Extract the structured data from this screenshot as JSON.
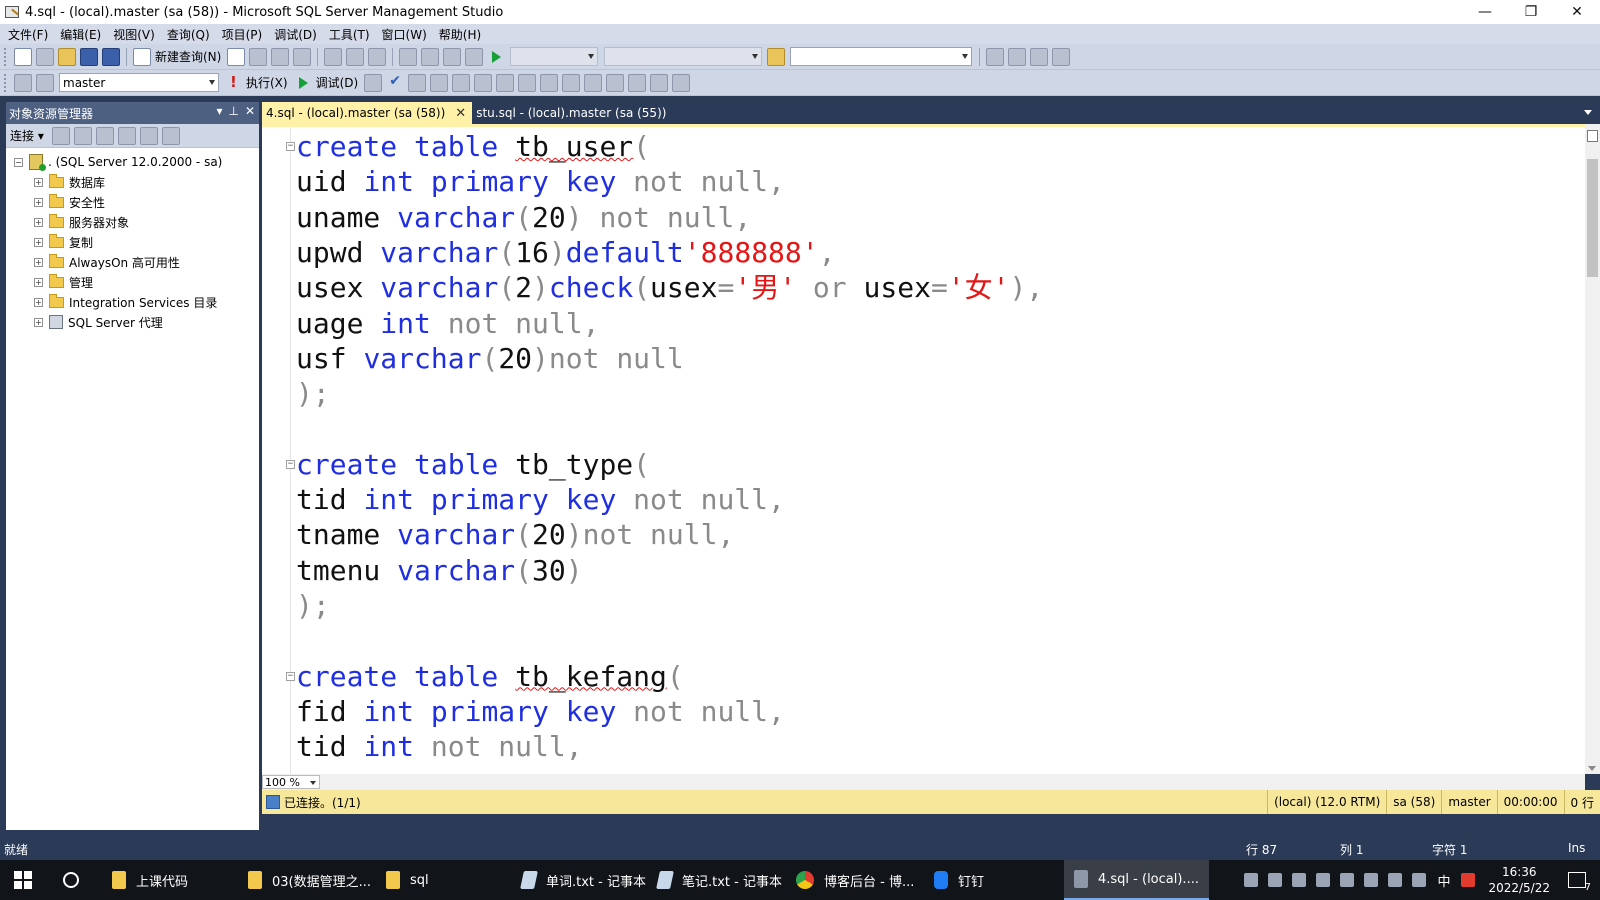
{
  "window": {
    "title": "4.sql - (local).master (sa (58)) - Microsoft SQL Server Management Studio",
    "controls": {
      "minimize": "—",
      "restore": "❐",
      "close": "✕"
    }
  },
  "menubar": [
    "文件(F)",
    "编辑(E)",
    "视图(V)",
    "查询(Q)",
    "项目(P)",
    "调试(D)",
    "工具(T)",
    "窗口(W)",
    "帮助(H)"
  ],
  "toolbar1": {
    "new_query": "新建查询(N)"
  },
  "toolbar2": {
    "database": "master",
    "execute": "执行(X)",
    "debug": "调试(D)"
  },
  "explorer": {
    "title": "对象资源管理器",
    "header_controls": [
      "▾",
      "⊥",
      "✕"
    ],
    "connect": "连接",
    "root": ". (SQL Server 12.0.2000 - sa)",
    "nodes": [
      "数据库",
      "安全性",
      "服务器对象",
      "复制",
      "AlwaysOn 高可用性",
      "管理",
      "Integration Services 目录",
      "SQL Server 代理"
    ]
  },
  "tabs": [
    {
      "label": "4.sql - (local).master (sa (58))",
      "active": true
    },
    {
      "label": "stu.sql - (local).master (sa (55))",
      "active": false
    }
  ],
  "code": [
    [
      [
        "create table ",
        "kw"
      ],
      [
        "tb_user",
        "tx sq"
      ],
      [
        "(",
        "gr"
      ]
    ],
    [
      [
        "uid ",
        "tx"
      ],
      [
        "int primary key ",
        "kw"
      ],
      [
        "not null,",
        "gr"
      ]
    ],
    [
      [
        "uname ",
        "tx"
      ],
      [
        "varchar",
        "kw"
      ],
      [
        "(",
        "gr"
      ],
      [
        "20",
        "tx"
      ],
      [
        ") not null,",
        "gr"
      ]
    ],
    [
      [
        "upwd ",
        "tx"
      ],
      [
        "varchar",
        "kw"
      ],
      [
        "(",
        "gr"
      ],
      [
        "16",
        "tx"
      ],
      [
        ")",
        "gr"
      ],
      [
        "default",
        "kw"
      ],
      [
        "'888888'",
        "st"
      ],
      [
        ",",
        "gr"
      ]
    ],
    [
      [
        "usex ",
        "tx"
      ],
      [
        "varchar",
        "kw"
      ],
      [
        "(",
        "gr"
      ],
      [
        "2",
        "tx"
      ],
      [
        ")",
        "gr"
      ],
      [
        "check",
        "kw"
      ],
      [
        "(",
        "gr"
      ],
      [
        "usex",
        "tx"
      ],
      [
        "=",
        "gr"
      ],
      [
        "'男'",
        "st"
      ],
      [
        " or ",
        "gr"
      ],
      [
        "usex",
        "tx"
      ],
      [
        "=",
        "gr"
      ],
      [
        "'女'",
        "st"
      ],
      [
        "),",
        "gr"
      ]
    ],
    [
      [
        "uage ",
        "tx"
      ],
      [
        "int ",
        "kw"
      ],
      [
        "not null,",
        "gr"
      ]
    ],
    [
      [
        "usf ",
        "tx"
      ],
      [
        "varchar",
        "kw"
      ],
      [
        "(",
        "gr"
      ],
      [
        "20",
        "tx"
      ],
      [
        ")not null",
        "gr"
      ]
    ],
    [
      [
        ");",
        "gr"
      ]
    ],
    [],
    [
      [
        "create table ",
        "kw"
      ],
      [
        "tb_type",
        "tx"
      ],
      [
        "(",
        "gr"
      ]
    ],
    [
      [
        "tid ",
        "tx"
      ],
      [
        "int primary key ",
        "kw"
      ],
      [
        "not null,",
        "gr"
      ]
    ],
    [
      [
        "tname ",
        "tx"
      ],
      [
        "varchar",
        "kw"
      ],
      [
        "(",
        "gr"
      ],
      [
        "20",
        "tx"
      ],
      [
        ")not null,",
        "gr"
      ]
    ],
    [
      [
        "tmenu ",
        "tx"
      ],
      [
        "varchar",
        "kw"
      ],
      [
        "(",
        "gr"
      ],
      [
        "30",
        "tx"
      ],
      [
        ")",
        "gr"
      ]
    ],
    [
      [
        ");",
        "gr"
      ]
    ],
    [],
    [
      [
        "create table ",
        "kw"
      ],
      [
        "tb_kefang",
        "tx sq"
      ],
      [
        "(",
        "gr"
      ]
    ],
    [
      [
        "fid ",
        "tx"
      ],
      [
        "int primary key ",
        "kw"
      ],
      [
        "not null,",
        "gr"
      ]
    ],
    [
      [
        "tid ",
        "tx"
      ],
      [
        "int ",
        "kw"
      ],
      [
        "not null,",
        "gr"
      ]
    ]
  ],
  "zoom": "100 %",
  "query_status": {
    "connected": "已连接。(1/1)",
    "server": "(local) (12.0 RTM)",
    "user": "sa (58)",
    "db": "master",
    "time": "00:00:00",
    "rows": "0 行"
  },
  "statusbar": {
    "ready": "就绪",
    "line": "行 87",
    "col": "列 1",
    "ch": "字符 1",
    "mode": "Ins"
  },
  "taskbar": {
    "items": [
      "上课代码",
      "03(数据管理之...",
      "sql",
      "单词.txt - 记事本",
      "笔记.txt - 记事本",
      "博客后台 - 博...",
      "钉钉",
      "4.sql - (local)...."
    ],
    "ime": "中",
    "time": "16:36",
    "date": "2022/5/22",
    "notif_count": "7"
  }
}
